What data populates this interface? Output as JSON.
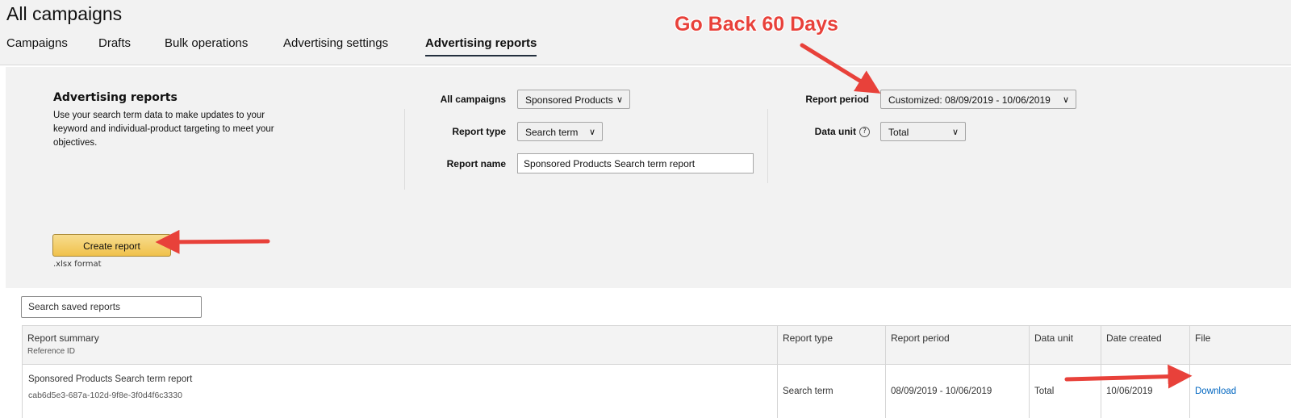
{
  "header": {
    "title": "All campaigns",
    "tabs": [
      {
        "label": "Campaigns",
        "active": false
      },
      {
        "label": "Drafts",
        "active": false
      },
      {
        "label": "Bulk operations",
        "active": false
      },
      {
        "label": "Advertising settings",
        "active": false
      },
      {
        "label": "Advertising reports",
        "active": true
      }
    ]
  },
  "panel": {
    "title": "Advertising reports",
    "description": "Use your search term data to make updates to your keyword and individual-product targeting to meet your objectives.",
    "fields": {
      "campaigns_label": "All campaigns",
      "campaigns_value": "Sponsored Products",
      "report_type_label": "Report type",
      "report_type_value": "Search term",
      "report_name_label": "Report name",
      "report_name_value": "Sponsored Products Search term report",
      "report_period_label": "Report period",
      "report_period_value": "Customized: 08/09/2019 - 10/06/2019",
      "data_unit_label": "Data unit",
      "data_unit_value": "Total"
    },
    "create_button": "Create report",
    "format_note": ".xlsx format"
  },
  "saved_reports": {
    "search_placeholder": "Search saved reports",
    "columns": {
      "summary": "Report summary",
      "reference": "Reference ID",
      "type": "Report type",
      "period": "Report period",
      "unit": "Data unit",
      "created": "Date created",
      "file": "File"
    },
    "rows": [
      {
        "summary": "Sponsored Products Search term report",
        "reference_id": "cab6d5e3-687a-102d-9f8e-3f0d4f6c3330",
        "type": "Search term",
        "period": "08/09/2019 - 10/06/2019",
        "unit": "Total",
        "created": "10/06/2019",
        "file": "Download"
      }
    ]
  },
  "annotation": {
    "text": "Go Back 60 Days",
    "color": "#e8413a"
  },
  "colors": {
    "accent_button": "#f0c14b",
    "link": "#0066c0",
    "tab_underline": "#232f3e"
  }
}
